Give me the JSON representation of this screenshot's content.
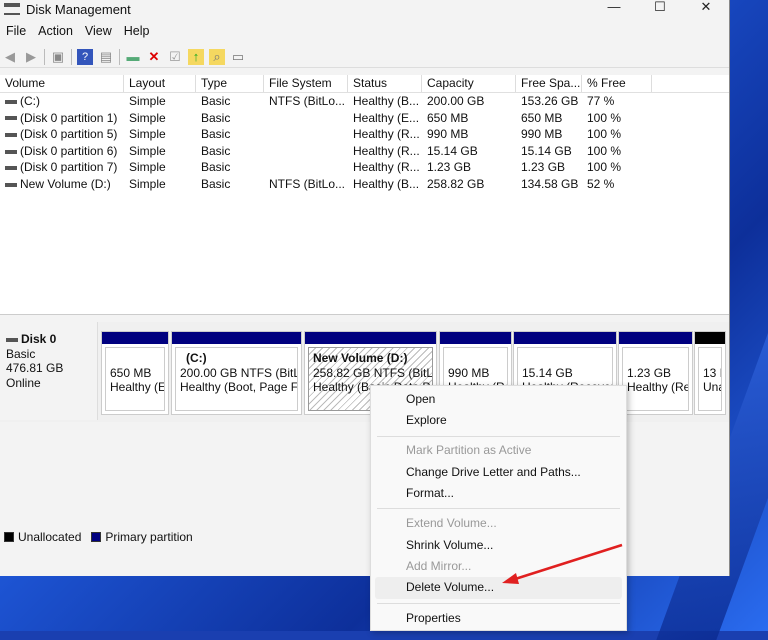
{
  "window": {
    "title": "Disk Management",
    "controls": [
      "—",
      "☐",
      "✕"
    ]
  },
  "menubar": [
    "File",
    "Action",
    "View",
    "Help"
  ],
  "table": {
    "columns": [
      "Volume",
      "Layout",
      "Type",
      "File System",
      "Status",
      "Capacity",
      "Free Spa...",
      "% Free"
    ],
    "rows": [
      [
        "(C:)",
        "Simple",
        "Basic",
        "NTFS (BitLo...",
        "Healthy (B...",
        "200.00 GB",
        "153.26 GB",
        "77 %"
      ],
      [
        "(Disk 0 partition 1)",
        "Simple",
        "Basic",
        "",
        "Healthy (E...",
        "650 MB",
        "650 MB",
        "100 %"
      ],
      [
        "(Disk 0 partition 5)",
        "Simple",
        "Basic",
        "",
        "Healthy (R...",
        "990 MB",
        "990 MB",
        "100 %"
      ],
      [
        "(Disk 0 partition 6)",
        "Simple",
        "Basic",
        "",
        "Healthy (R...",
        "15.14 GB",
        "15.14 GB",
        "100 %"
      ],
      [
        "(Disk 0 partition 7)",
        "Simple",
        "Basic",
        "",
        "Healthy (R...",
        "1.23 GB",
        "1.23 GB",
        "100 %"
      ],
      [
        "New Volume (D:)",
        "Simple",
        "Basic",
        "NTFS (BitLo...",
        "Healthy (B...",
        "258.82 GB",
        "134.58 GB",
        "52 %"
      ]
    ]
  },
  "disk": {
    "name": "Disk 0",
    "type": "Basic",
    "size": "476.81 GB",
    "status": "Online",
    "partitions": [
      {
        "title": "",
        "line1": "650 MB",
        "line2": "Healthy (EI"
      },
      {
        "title": "(C:)",
        "line1": "200.00 GB NTFS (BitLoc",
        "line2": "Healthy (Boot, Page Fil"
      },
      {
        "title": "New Volume  (D:)",
        "line1": "258.82 GB NTFS (BitLocl",
        "line2": "Healthy (Basic Data Par"
      },
      {
        "title": "",
        "line1": "990 MB",
        "line2": "Healthy (Re"
      },
      {
        "title": "",
        "line1": "15.14 GB",
        "line2": "Healthy (Recover"
      },
      {
        "title": "",
        "line1": "1.23 GB",
        "line2": "Healthy (Rec"
      },
      {
        "title": "",
        "line1": "13 I",
        "line2": "Una"
      }
    ]
  },
  "legend": {
    "unallocated": "Unallocated",
    "primary": "Primary partition",
    "colors": {
      "unallocated": "#000000",
      "primary": "#00007f"
    }
  },
  "context_menu": {
    "items": [
      {
        "label": "Open",
        "disabled": false
      },
      {
        "label": "Explore",
        "disabled": false
      },
      {
        "label": "Mark Partition as Active",
        "disabled": true
      },
      {
        "label": "Change Drive Letter and Paths...",
        "disabled": false
      },
      {
        "label": "Format...",
        "disabled": false
      },
      {
        "label": "Extend Volume...",
        "disabled": true
      },
      {
        "label": "Shrink Volume...",
        "disabled": false
      },
      {
        "label": "Add Mirror...",
        "disabled": true
      },
      {
        "label": "Delete Volume...",
        "disabled": false
      },
      {
        "label": "Properties",
        "disabled": false
      }
    ]
  },
  "annotation_color": "#e02020"
}
